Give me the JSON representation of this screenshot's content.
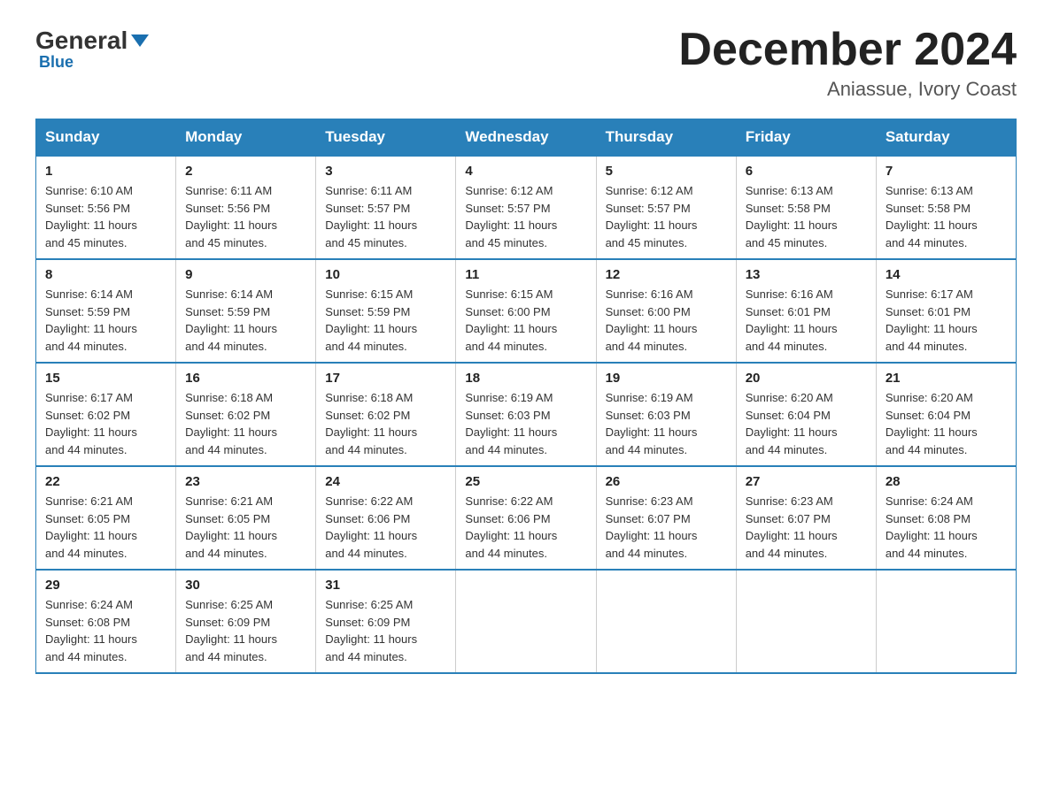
{
  "logo": {
    "general": "General",
    "triangle": "",
    "blue": "Blue"
  },
  "header": {
    "month": "December 2024",
    "location": "Aniassue, Ivory Coast"
  },
  "days_of_week": [
    "Sunday",
    "Monday",
    "Tuesday",
    "Wednesday",
    "Thursday",
    "Friday",
    "Saturday"
  ],
  "weeks": [
    [
      {
        "day": "1",
        "sunrise": "6:10 AM",
        "sunset": "5:56 PM",
        "daylight": "11 hours and 45 minutes."
      },
      {
        "day": "2",
        "sunrise": "6:11 AM",
        "sunset": "5:56 PM",
        "daylight": "11 hours and 45 minutes."
      },
      {
        "day": "3",
        "sunrise": "6:11 AM",
        "sunset": "5:57 PM",
        "daylight": "11 hours and 45 minutes."
      },
      {
        "day": "4",
        "sunrise": "6:12 AM",
        "sunset": "5:57 PM",
        "daylight": "11 hours and 45 minutes."
      },
      {
        "day": "5",
        "sunrise": "6:12 AM",
        "sunset": "5:57 PM",
        "daylight": "11 hours and 45 minutes."
      },
      {
        "day": "6",
        "sunrise": "6:13 AM",
        "sunset": "5:58 PM",
        "daylight": "11 hours and 45 minutes."
      },
      {
        "day": "7",
        "sunrise": "6:13 AM",
        "sunset": "5:58 PM",
        "daylight": "11 hours and 44 minutes."
      }
    ],
    [
      {
        "day": "8",
        "sunrise": "6:14 AM",
        "sunset": "5:59 PM",
        "daylight": "11 hours and 44 minutes."
      },
      {
        "day": "9",
        "sunrise": "6:14 AM",
        "sunset": "5:59 PM",
        "daylight": "11 hours and 44 minutes."
      },
      {
        "day": "10",
        "sunrise": "6:15 AM",
        "sunset": "5:59 PM",
        "daylight": "11 hours and 44 minutes."
      },
      {
        "day": "11",
        "sunrise": "6:15 AM",
        "sunset": "6:00 PM",
        "daylight": "11 hours and 44 minutes."
      },
      {
        "day": "12",
        "sunrise": "6:16 AM",
        "sunset": "6:00 PM",
        "daylight": "11 hours and 44 minutes."
      },
      {
        "day": "13",
        "sunrise": "6:16 AM",
        "sunset": "6:01 PM",
        "daylight": "11 hours and 44 minutes."
      },
      {
        "day": "14",
        "sunrise": "6:17 AM",
        "sunset": "6:01 PM",
        "daylight": "11 hours and 44 minutes."
      }
    ],
    [
      {
        "day": "15",
        "sunrise": "6:17 AM",
        "sunset": "6:02 PM",
        "daylight": "11 hours and 44 minutes."
      },
      {
        "day": "16",
        "sunrise": "6:18 AM",
        "sunset": "6:02 PM",
        "daylight": "11 hours and 44 minutes."
      },
      {
        "day": "17",
        "sunrise": "6:18 AM",
        "sunset": "6:02 PM",
        "daylight": "11 hours and 44 minutes."
      },
      {
        "day": "18",
        "sunrise": "6:19 AM",
        "sunset": "6:03 PM",
        "daylight": "11 hours and 44 minutes."
      },
      {
        "day": "19",
        "sunrise": "6:19 AM",
        "sunset": "6:03 PM",
        "daylight": "11 hours and 44 minutes."
      },
      {
        "day": "20",
        "sunrise": "6:20 AM",
        "sunset": "6:04 PM",
        "daylight": "11 hours and 44 minutes."
      },
      {
        "day": "21",
        "sunrise": "6:20 AM",
        "sunset": "6:04 PM",
        "daylight": "11 hours and 44 minutes."
      }
    ],
    [
      {
        "day": "22",
        "sunrise": "6:21 AM",
        "sunset": "6:05 PM",
        "daylight": "11 hours and 44 minutes."
      },
      {
        "day": "23",
        "sunrise": "6:21 AM",
        "sunset": "6:05 PM",
        "daylight": "11 hours and 44 minutes."
      },
      {
        "day": "24",
        "sunrise": "6:22 AM",
        "sunset": "6:06 PM",
        "daylight": "11 hours and 44 minutes."
      },
      {
        "day": "25",
        "sunrise": "6:22 AM",
        "sunset": "6:06 PM",
        "daylight": "11 hours and 44 minutes."
      },
      {
        "day": "26",
        "sunrise": "6:23 AM",
        "sunset": "6:07 PM",
        "daylight": "11 hours and 44 minutes."
      },
      {
        "day": "27",
        "sunrise": "6:23 AM",
        "sunset": "6:07 PM",
        "daylight": "11 hours and 44 minutes."
      },
      {
        "day": "28",
        "sunrise": "6:24 AM",
        "sunset": "6:08 PM",
        "daylight": "11 hours and 44 minutes."
      }
    ],
    [
      {
        "day": "29",
        "sunrise": "6:24 AM",
        "sunset": "6:08 PM",
        "daylight": "11 hours and 44 minutes."
      },
      {
        "day": "30",
        "sunrise": "6:25 AM",
        "sunset": "6:09 PM",
        "daylight": "11 hours and 44 minutes."
      },
      {
        "day": "31",
        "sunrise": "6:25 AM",
        "sunset": "6:09 PM",
        "daylight": "11 hours and 44 minutes."
      },
      null,
      null,
      null,
      null
    ]
  ],
  "labels": {
    "sunrise": "Sunrise:",
    "sunset": "Sunset:",
    "daylight": "Daylight:"
  }
}
